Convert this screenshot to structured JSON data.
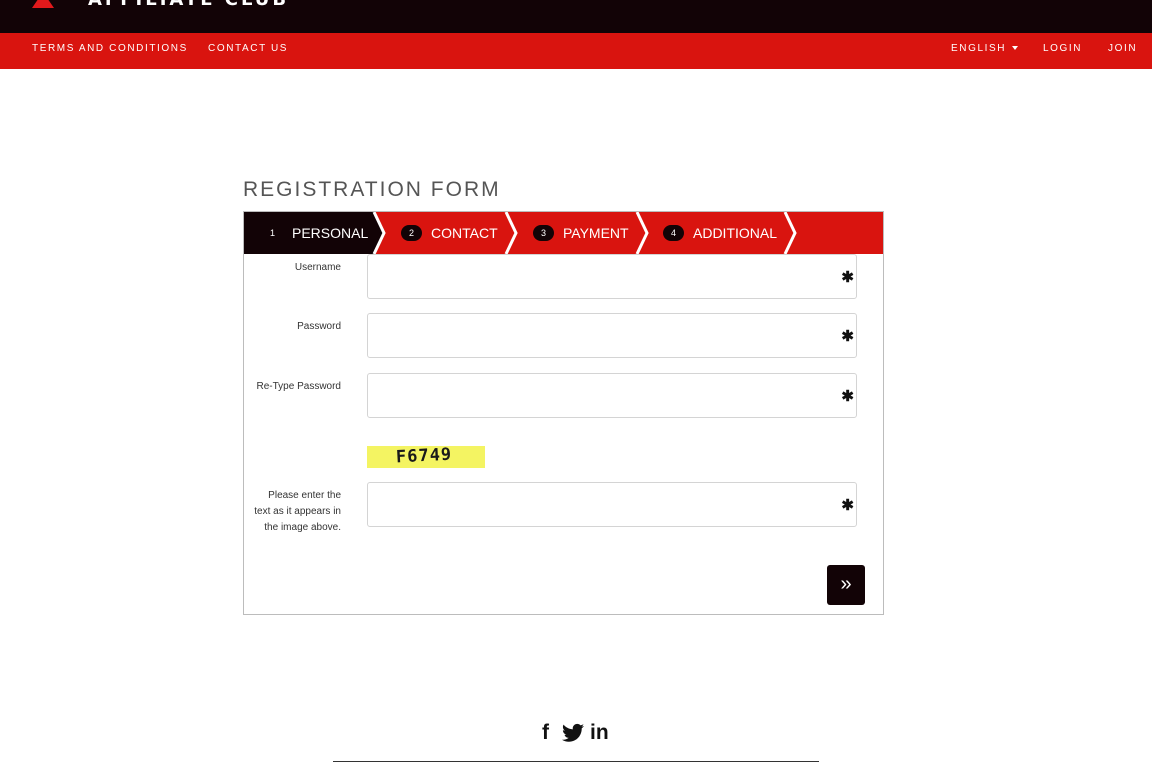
{
  "header": {
    "logo_text": "AFFILIATE CLUB",
    "nav_left": [
      "TERMS AND CONDITIONS",
      "CONTACT US"
    ],
    "language": "ENGLISH",
    "login": "LOGIN",
    "join": "JOIN"
  },
  "form": {
    "title": "REGISTRATION FORM",
    "steps": [
      {
        "num": "1",
        "label": "PERSONAL"
      },
      {
        "num": "2",
        "label": "CONTACT"
      },
      {
        "num": "3",
        "label": "PAYMENT"
      },
      {
        "num": "4",
        "label": "ADDITIONAL"
      }
    ],
    "fields": {
      "username": {
        "label": "Username",
        "value": ""
      },
      "password": {
        "label": "Password",
        "value": ""
      },
      "retype": {
        "label": "Re-Type Password",
        "value": ""
      },
      "captcha_input": {
        "label": "Please enter the text as it appears in the image above.",
        "value": ""
      }
    },
    "required_marker": "✱",
    "captcha_text": "F6749",
    "next_label": "»"
  },
  "footer": {
    "social": [
      {
        "icon": "facebook-icon",
        "glyph": "f"
      },
      {
        "icon": "twitter-icon",
        "glyph": "🐦"
      },
      {
        "icon": "linkedin-icon",
        "glyph": "in"
      }
    ]
  },
  "colors": {
    "header_bg": "#120306",
    "accent": "#d9140f",
    "captcha_bg": "#f4f462"
  }
}
